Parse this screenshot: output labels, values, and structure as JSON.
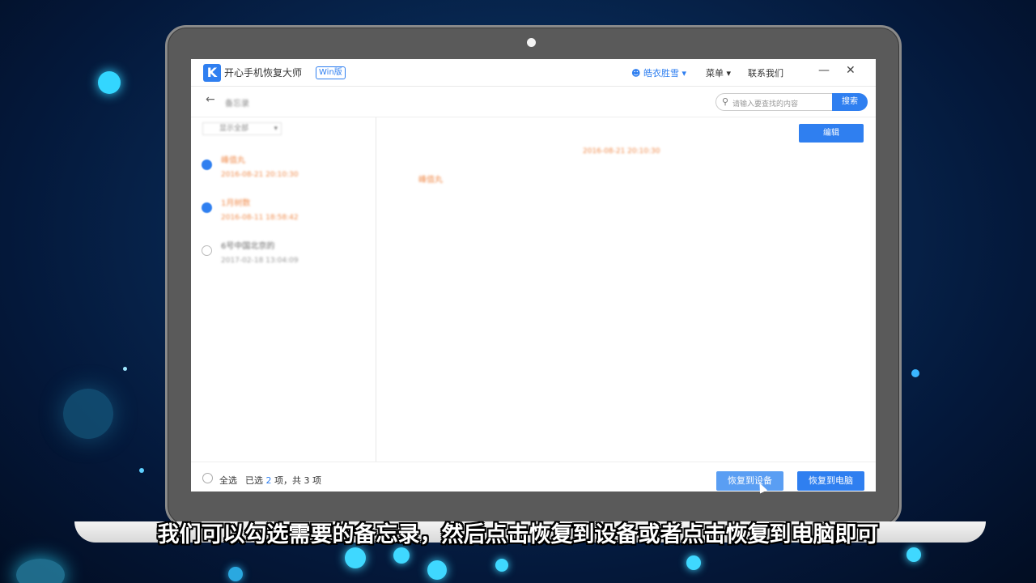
{
  "app": {
    "name": "开心手机恢复大师",
    "edition_badge": "Win版",
    "user_name": "皓衣胜雪",
    "menu_label": "菜单",
    "contact_label": "联系我们"
  },
  "toolbar": {
    "section_title": "备忘录",
    "search_placeholder": "请输入要查找的内容",
    "search_button": "搜索"
  },
  "list": {
    "filter_label": "显示全部",
    "items": [
      {
        "title": "峰值丸",
        "date": "2016-08-21 20:10:30",
        "checked": true
      },
      {
        "title": "1月树数",
        "date": "2016-08-11 18:58:42",
        "checked": true
      },
      {
        "title": "6号中国北京的",
        "date": "2017-02-18 13:04:09",
        "checked": false
      }
    ]
  },
  "detail": {
    "edit_button": "编辑",
    "date": "2016-08-21 20:10:30",
    "body": "峰值丸"
  },
  "footer": {
    "select_all": "全选",
    "selected_prefix": "已选",
    "selected_count": "2",
    "selected_suffix": "项，共 3 项",
    "restore_device": "恢复到设备",
    "restore_pc": "恢复到电脑"
  },
  "subtitle": "我们可以勾选需要的备忘录，然后点击恢复到设备或者点击恢复到电脑即可",
  "colors": {
    "accent": "#2f7ff0",
    "note_text": "#f08a4a"
  }
}
